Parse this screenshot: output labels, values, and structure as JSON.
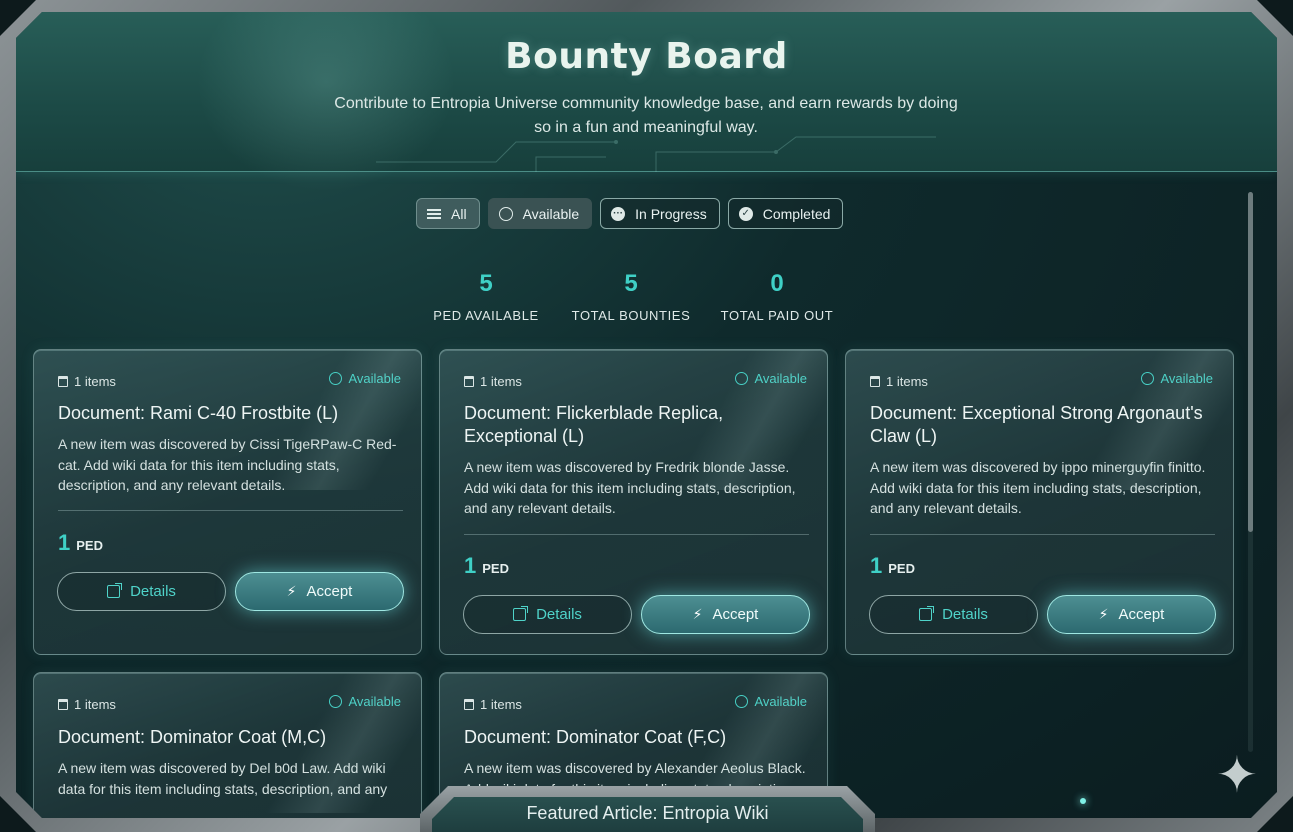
{
  "header": {
    "title": "Bounty Board",
    "subtitle": "Contribute to Entropia Universe community knowledge base, and earn rewards by doing so in a fun and meaningful way."
  },
  "filters": [
    {
      "label": "All",
      "icon": "list-icon",
      "active": true
    },
    {
      "label": "Available",
      "icon": "circle-icon"
    },
    {
      "label": "In Progress",
      "icon": "dots-icon"
    },
    {
      "label": "Completed",
      "icon": "check-icon"
    }
  ],
  "stats": [
    {
      "value": "5",
      "label": "PED AVAILABLE"
    },
    {
      "value": "5",
      "label": "TOTAL BOUNTIES"
    },
    {
      "value": "0",
      "label": "TOTAL PAID OUT"
    }
  ],
  "bounties": [
    {
      "items": "1 items",
      "status": "Available",
      "title": "Document: Rami C-40 Frostbite (L)",
      "description": "A new item was discovered by Cissi TigeRPaw-C Red-cat. Add wiki data for this item including stats, description, and any relevant details.",
      "reward_amount": "1",
      "reward_unit": "PED",
      "details_label": "Details",
      "accept_label": "Accept"
    },
    {
      "items": "1 items",
      "status": "Available",
      "title": "Document: Flickerblade Replica, Exceptional (L)",
      "description": "A new item was discovered by Fredrik blonde Jasse. Add wiki data for this item including stats, description, and any relevant details.",
      "reward_amount": "1",
      "reward_unit": "PED",
      "details_label": "Details",
      "accept_label": "Accept"
    },
    {
      "items": "1 items",
      "status": "Available",
      "title": "Document: Exceptional Strong Argonaut's Claw (L)",
      "description": "A new item was discovered by ippo minerguyfin finitto. Add wiki data for this item including stats, description, and any relevant details.",
      "reward_amount": "1",
      "reward_unit": "PED",
      "details_label": "Details",
      "accept_label": "Accept"
    },
    {
      "items": "1 items",
      "status": "Available",
      "title": "Document: Dominator Coat (M,C)",
      "description": "A new item was discovered by Del b0d Law. Add wiki data for this item including stats, description, and any"
    },
    {
      "items": "1 items",
      "status": "Available",
      "title": "Document: Dominator Coat (F,C)",
      "description": "A new item was discovered by Alexander Aeolus Black. Add wiki data for this item including stats, description"
    }
  ],
  "footer": {
    "label": "Featured Article: Entropia Wiki"
  },
  "colors": {
    "accent": "#3fd0c6",
    "panel": "#0f2a2c",
    "header": "#1c4a46"
  }
}
